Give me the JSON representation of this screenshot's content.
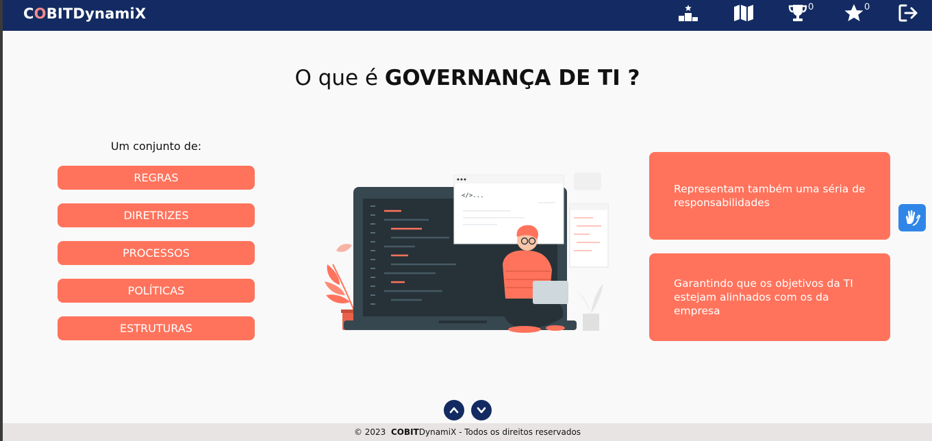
{
  "header": {
    "brand_c": "C",
    "brand_o": "O",
    "brand_rest": "BITDynamiX",
    "trophy_count": "0",
    "star_count": "0",
    "icons": [
      "ranking-podium-icon",
      "map-icon",
      "trophy-icon",
      "star-icon",
      "logout-icon"
    ]
  },
  "main": {
    "title_prefix": "O que é ",
    "title_bold": "GOVERNANÇA DE TI ?",
    "intro": "Um conjunto de:",
    "items": [
      "REGRAS",
      "DIRETRIZES",
      "PROCESSOS",
      "POLÍTICAS",
      "ESTRUTURAS"
    ],
    "cards": [
      "Representam também uma séria de responsabilidades",
      "Garantindo que os objetivos da TI estejam alinhados com os da empresa"
    ],
    "illustration_code_label": "</>..."
  },
  "footer": {
    "copyright": "© 2023",
    "brand": "COBIT",
    "brand_rest": "DynamiX",
    "suffix": " - Todos os direitos reservados"
  },
  "colors": {
    "navbar": "#132b62",
    "accent": "#ff735c",
    "a11y": "#2f86e6",
    "footer_bg": "#e8e4e4"
  }
}
